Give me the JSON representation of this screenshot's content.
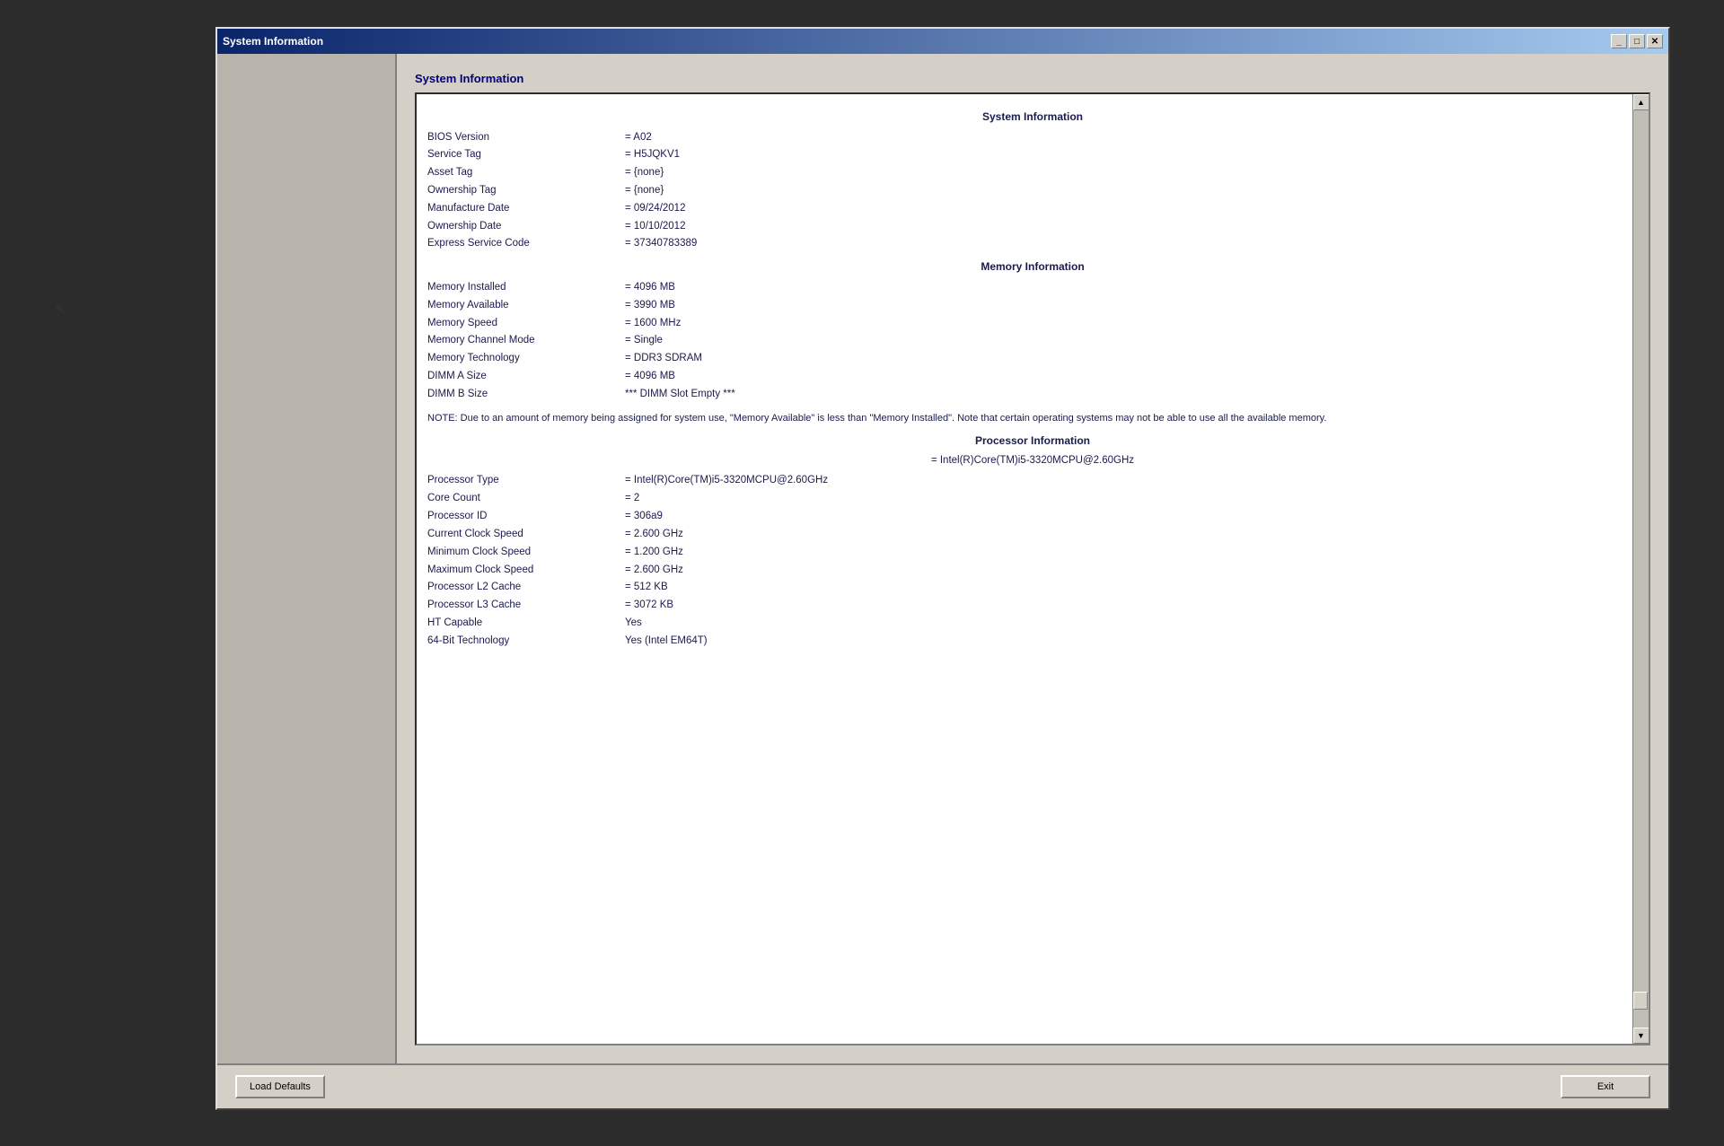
{
  "window": {
    "title": "System Information",
    "close_btn": "✕",
    "minimize_btn": "_",
    "maximize_btn": "□"
  },
  "scroll": {
    "up_arrow": "▲",
    "down_arrow": "▼"
  },
  "sections": {
    "system": {
      "header": "System Information",
      "fields": [
        {
          "label": "BIOS Version",
          "value": "= A02"
        },
        {
          "label": "Service Tag",
          "value": "= H5JQKV1"
        },
        {
          "label": "Asset Tag",
          "value": "= {none}"
        },
        {
          "label": "Ownership Tag",
          "value": "= {none}"
        },
        {
          "label": "Manufacture Date",
          "value": "= 09/24/2012"
        },
        {
          "label": "Ownership Date",
          "value": "= 10/10/2012"
        },
        {
          "label": "Express Service Code",
          "value": "= 37340783389"
        }
      ]
    },
    "memory": {
      "header": "Memory Information",
      "fields": [
        {
          "label": "Memory Installed",
          "value": "= 4096 MB"
        },
        {
          "label": "Memory Available",
          "value": "= 3990 MB"
        },
        {
          "label": "Memory Speed",
          "value": "= 1600 MHz"
        },
        {
          "label": "Memory Channel Mode",
          "value": "= Single"
        },
        {
          "label": "Memory Technology",
          "value": "= DDR3 SDRAM"
        },
        {
          "label": "DIMM A Size",
          "value": "= 4096 MB"
        },
        {
          "label": "DIMM B Size",
          "value": "*** DIMM Slot Empty ***"
        }
      ],
      "note": "NOTE: Due to an amount of memory being assigned for system use, \"Memory Available\" is less than \"Memory Installed\". Note that certain operating systems may not be able to use all the available memory."
    },
    "processor": {
      "header": "Processor Information",
      "processor_name": "= Intel(R)Core(TM)i5-3320MCPU@2.60GHz",
      "fields": [
        {
          "label": "Processor Type",
          "value": "= Intel(R)Core(TM)i5-3320MCPU@2.60GHz"
        },
        {
          "label": "Core Count",
          "value": "= 2"
        },
        {
          "label": "Processor ID",
          "value": "= 306a9"
        },
        {
          "label": "Current Clock Speed",
          "value": "= 2.600 GHz"
        },
        {
          "label": "Minimum Clock Speed",
          "value": "= 1.200 GHz"
        },
        {
          "label": "Maximum Clock Speed",
          "value": "= 2.600 GHz"
        },
        {
          "label": "Processor L2 Cache",
          "value": "= 512 KB"
        },
        {
          "label": "Processor L3 Cache",
          "value": "= 3072 KB"
        },
        {
          "label": "HT Capable",
          "value": "Yes"
        },
        {
          "label": "64-Bit Technology",
          "value": "Yes (Intel EM64T)"
        }
      ]
    }
  },
  "buttons": {
    "load_defaults": "Load Defaults",
    "exit": "Exit"
  },
  "box_title": "System Information"
}
